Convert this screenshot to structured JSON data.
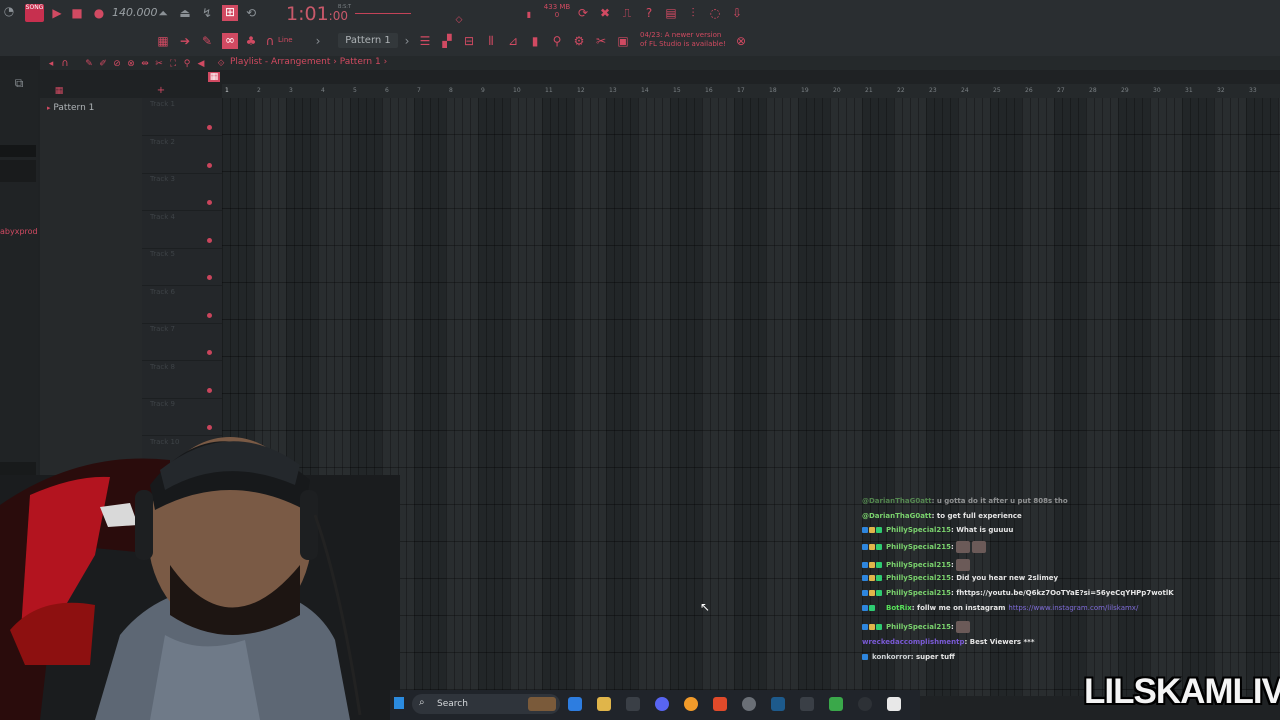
{
  "toolbar": {
    "song_badge": "SONG",
    "tempo": "140.000",
    "time_main": "1:01",
    "time_sub": ":00",
    "time_unit": "B:S:T",
    "memory": "433 MB",
    "memory_value": "0",
    "news": "04/23: A newer version of FL Studio is available!",
    "snap": "Line",
    "pattern_selector": "Pattern 1"
  },
  "playlist": {
    "breadcrumb": "Playlist - Arrangement",
    "breadcrumb_pattern": "Pattern 1",
    "browser_item": "Pattern 1",
    "left_text": "abyxprod",
    "tracks": [
      "Track 1",
      "Track 2",
      "Track 3",
      "Track 4",
      "Track 5",
      "Track 6",
      "Track 7",
      "Track 8",
      "Track 9",
      "Track 10"
    ],
    "ruler": [
      "1",
      "2",
      "3",
      "4",
      "5",
      "6",
      "7",
      "8",
      "9",
      "10",
      "11",
      "12",
      "13",
      "14",
      "15",
      "16",
      "17",
      "18",
      "19",
      "20",
      "21",
      "22",
      "23",
      "24",
      "25",
      "26",
      "27",
      "28",
      "29",
      "30",
      "31",
      "32",
      "33"
    ]
  },
  "chat": {
    "lines": [
      {
        "user": "@DarianThaG0att",
        "message": ": u gotta do it after u put 808s tho",
        "kind": "mention"
      },
      {
        "user": "@DarianThaG0att",
        "message": ": to get full experience",
        "kind": "mention"
      },
      {
        "user": "PhillySpecial215",
        "message": ": What is guuuu",
        "kind": "p"
      },
      {
        "user": "PhillySpecial215",
        "message": ":",
        "kind": "p",
        "emotes": 2
      },
      {
        "user": "PhillySpecial215",
        "message": ":",
        "kind": "p",
        "emotes": 1
      },
      {
        "user": "PhillySpecial215",
        "message": ": Did you hear new 2slimey",
        "kind": "p"
      },
      {
        "user": "PhillySpecial215",
        "message": ": fhttps://youtu.be/Q6kz7OoTYaE?si=56yeCqYHPp7wotlK",
        "kind": "p"
      },
      {
        "user": "BotRix",
        "message": ": follw me on instagram",
        "link": "https://www.instagram.com/lilskamx/",
        "kind": "b"
      },
      {
        "user": "PhillySpecial215",
        "message": ":",
        "kind": "p",
        "emotes": 1
      },
      {
        "user": "wreckedaccomplishmentp",
        "message": ": Best Viewers ***",
        "kind": "w"
      },
      {
        "user": "konkorror",
        "message": ": super tuff",
        "kind": "k"
      }
    ]
  },
  "taskbar": {
    "search_placeholder": "Search"
  },
  "watermark": "LILSKAMLIVE",
  "colors": {
    "accent": "#d14a62",
    "bg": "#1f2224",
    "grid": "#262a2c"
  }
}
